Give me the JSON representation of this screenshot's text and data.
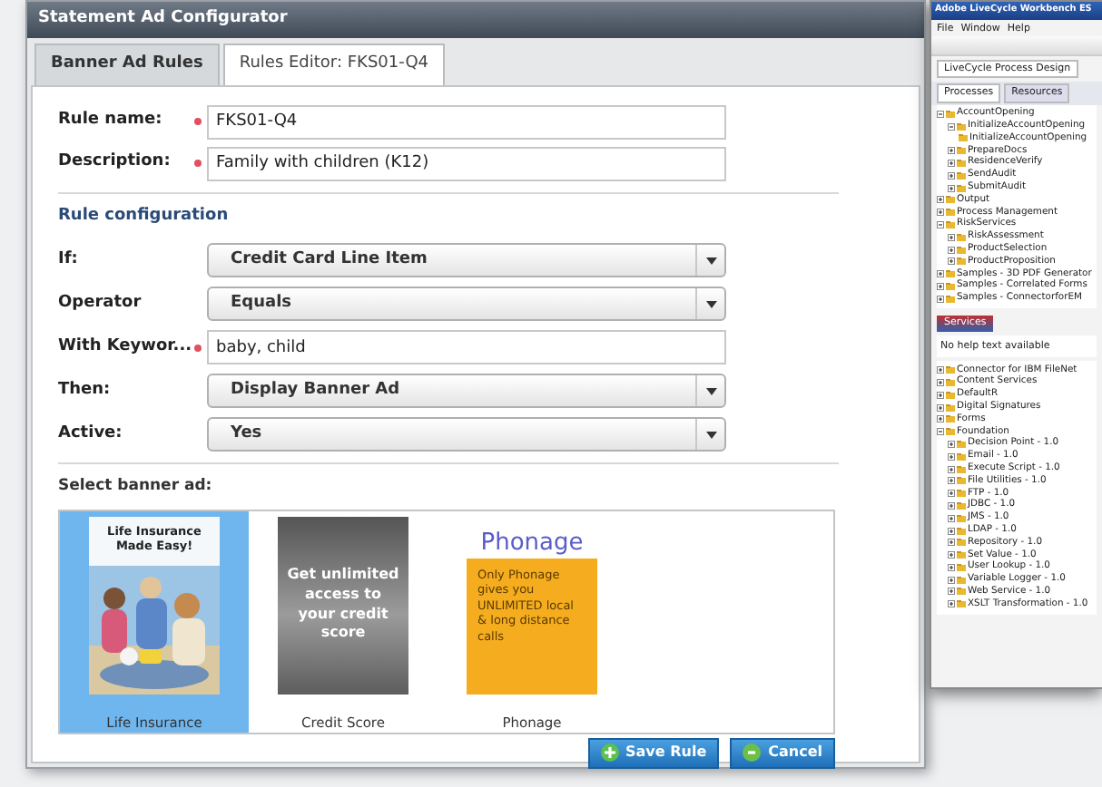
{
  "window": {
    "title": "Statement Ad Configurator"
  },
  "tabs": [
    {
      "label": "Banner Ad Rules",
      "selected": false
    },
    {
      "label": "Rules Editor: FKS01-Q4",
      "selected": true
    }
  ],
  "rule_fields": [
    {
      "kind": "text",
      "label": "Rule name:",
      "required": true,
      "value": "FKS01-Q4"
    },
    {
      "kind": "text",
      "label": "Description:",
      "required": true,
      "value": "Family with children (K12)"
    }
  ],
  "config_heading": "Rule configuration",
  "config_fields": [
    {
      "kind": "select",
      "label": "If:",
      "required": false,
      "value": "Credit Card Line Item"
    },
    {
      "kind": "select",
      "label": "Operator",
      "required": false,
      "value": "Equals"
    },
    {
      "kind": "text",
      "label": "With Keywor...",
      "required": true,
      "value": "baby, child"
    },
    {
      "kind": "select",
      "label": "Then:",
      "required": false,
      "value": "Display Banner Ad"
    },
    {
      "kind": "select",
      "label": "Active:",
      "required": false,
      "value": "Yes"
    }
  ],
  "banner_heading": "Select banner ad:",
  "banners": [
    {
      "headline": "Life Insurance Made Easy!",
      "label": "Life Insurance",
      "selected": true
    },
    {
      "kind": "text-card",
      "headline": "Get unlimited access to your credit score",
      "label": "Credit Score",
      "selected": false
    },
    {
      "kind": "brand",
      "brand": "Phonage",
      "headline": "Only Phonage gives you UNLIMITED local & long distance calls",
      "label": "Phonage",
      "selected": false
    }
  ],
  "buttons": [
    {
      "kind": "save",
      "label": "Save Rule"
    },
    {
      "kind": "cancel",
      "label": "Cancel"
    }
  ],
  "background_window": {
    "title": "Adobe LiveCycle Workbench ES",
    "menu": [
      "File",
      "Window",
      "Help"
    ],
    "perspective_tab": "LiveCycle Process Design",
    "panel_tabs": [
      {
        "label": "Processes",
        "selected": true
      },
      {
        "label": "Resources",
        "selected": false
      }
    ],
    "tree": [
      {
        "label": "AccountOpening",
        "expanded": true,
        "children": [
          {
            "label": "InitializeAccountOpening",
            "expanded": true,
            "children": [
              {
                "label": "InitializeAccountOpening"
              }
            ]
          },
          {
            "label": "PrepareDocs",
            "expanded": false
          },
          {
            "label": "ResidenceVerify",
            "expanded": false
          },
          {
            "label": "SendAudit",
            "expanded": false
          },
          {
            "label": "SubmitAudit",
            "expanded": false
          }
        ]
      },
      {
        "label": "Output",
        "expanded": false
      },
      {
        "label": "Process Management",
        "expanded": false
      },
      {
        "label": "RiskServices",
        "expanded": true,
        "children": [
          {
            "label": "RiskAssessment",
            "expanded": false
          },
          {
            "label": "ProductSelection",
            "expanded": false
          },
          {
            "label": "ProductProposition",
            "expanded": false
          }
        ]
      },
      {
        "label": "Samples - 3D PDF Generator",
        "expanded": false
      },
      {
        "label": "Samples - Correlated Forms",
        "expanded": false
      },
      {
        "label": "Samples - ConnectorforEM",
        "expanded": false
      }
    ],
    "services_tab": "Services",
    "services_message": "No help text available",
    "services_tree": [
      {
        "label": "Connector for IBM FileNet",
        "expanded": false
      },
      {
        "label": "Content Services",
        "expanded": false
      },
      {
        "label": "DefaultR",
        "expanded": false
      },
      {
        "label": "Digital Signatures",
        "expanded": false
      },
      {
        "label": "Forms",
        "expanded": false
      },
      {
        "label": "Foundation",
        "expanded": true,
        "children": [
          {
            "label": "Decision Point - 1.0",
            "expanded": false
          },
          {
            "label": "Email - 1.0",
            "expanded": false
          },
          {
            "label": "Execute Script - 1.0",
            "expanded": false
          },
          {
            "label": "File Utilities - 1.0",
            "expanded": false
          },
          {
            "label": "FTP - 1.0",
            "expanded": false
          },
          {
            "label": "JDBC - 1.0",
            "expanded": false
          },
          {
            "label": "JMS - 1.0",
            "expanded": false
          },
          {
            "label": "LDAP - 1.0",
            "expanded": false
          },
          {
            "label": "Repository - 1.0",
            "expanded": false
          },
          {
            "label": "Set Value - 1.0",
            "expanded": false
          },
          {
            "label": "User Lookup - 1.0",
            "expanded": false
          },
          {
            "label": "Variable Logger - 1.0",
            "expanded": false
          },
          {
            "label": "Web Service - 1.0",
            "expanded": false
          },
          {
            "label": "XSLT Transformation - 1.0",
            "expanded": false
          }
        ]
      }
    ]
  }
}
